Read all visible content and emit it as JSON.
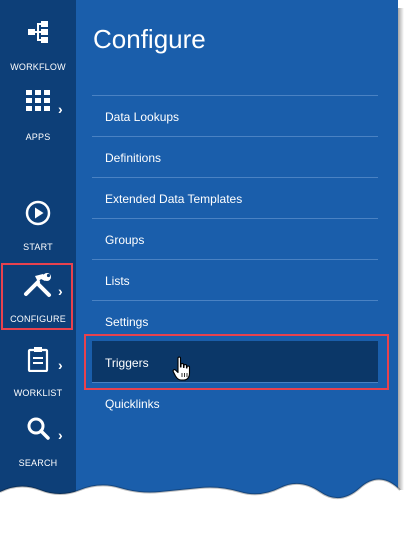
{
  "page": {
    "title": "Configure"
  },
  "rail": {
    "items": [
      {
        "label": "WORKFLOW",
        "icon": "workflow-icon",
        "has_chevron": false
      },
      {
        "label": "APPS",
        "icon": "apps-grid-icon",
        "has_chevron": true
      },
      {
        "label": "START",
        "icon": "play-circle-icon",
        "has_chevron": false
      },
      {
        "label": "CONFIGURE",
        "icon": "tools-icon",
        "has_chevron": true,
        "highlighted": true
      },
      {
        "label": "WORKLIST",
        "icon": "clipboard-icon",
        "has_chevron": true
      },
      {
        "label": "SEARCH",
        "icon": "search-icon",
        "has_chevron": true
      }
    ]
  },
  "menu": {
    "items": [
      {
        "label": "Data Lookups"
      },
      {
        "label": "Definitions"
      },
      {
        "label": "Extended Data Templates"
      },
      {
        "label": "Groups"
      },
      {
        "label": "Lists"
      },
      {
        "label": "Settings"
      },
      {
        "label": "Triggers",
        "selected": true
      },
      {
        "label": "Quicklinks"
      }
    ]
  },
  "colors": {
    "rail_bg": "#0d3f78",
    "panel_bg": "#1a5eab",
    "selected_bg": "#0b3768",
    "highlight_border": "#e8424e"
  }
}
